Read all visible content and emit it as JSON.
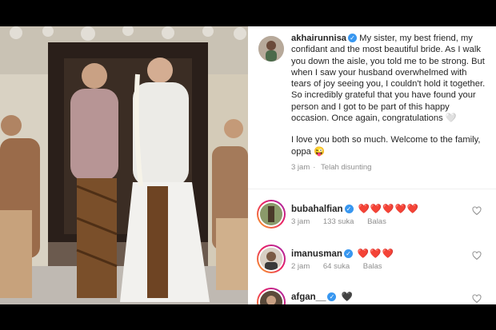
{
  "post": {
    "author": "akhairunnisa",
    "caption_paragraphs": [
      "My sister, my best friend, my confidant and the most beautiful bride. As I walk you down the aisle, you told me to be strong. But when I saw your husband overwhelmed with tears of joy seeing you, I couldn't hold it together. So incredibly grateful that you have found your person and I got to be part of this happy occasion. Once again, congratulations 🤍",
      "I love you both so much. Welcome to the family, oppa 😜"
    ],
    "time": "3 jam",
    "edited_label": "Telah disunting"
  },
  "comments": [
    {
      "user": "bubahalfian",
      "text": "❤️❤️❤️❤️❤️",
      "time": "3 jam",
      "likes": "133 suka",
      "reply": "Balas",
      "verified": true
    },
    {
      "user": "imanusman",
      "text": "❤️❤️❤️",
      "time": "2 jam",
      "likes": "64 suka",
      "reply": "Balas",
      "verified": true
    },
    {
      "user": "afgan__",
      "text": "🖤",
      "time": "",
      "likes": "",
      "reply": "",
      "verified": true
    }
  ],
  "colors": {
    "link": "#3897f0",
    "text": "#262626",
    "muted": "#8e8e8e",
    "heart": "#ed4956"
  }
}
